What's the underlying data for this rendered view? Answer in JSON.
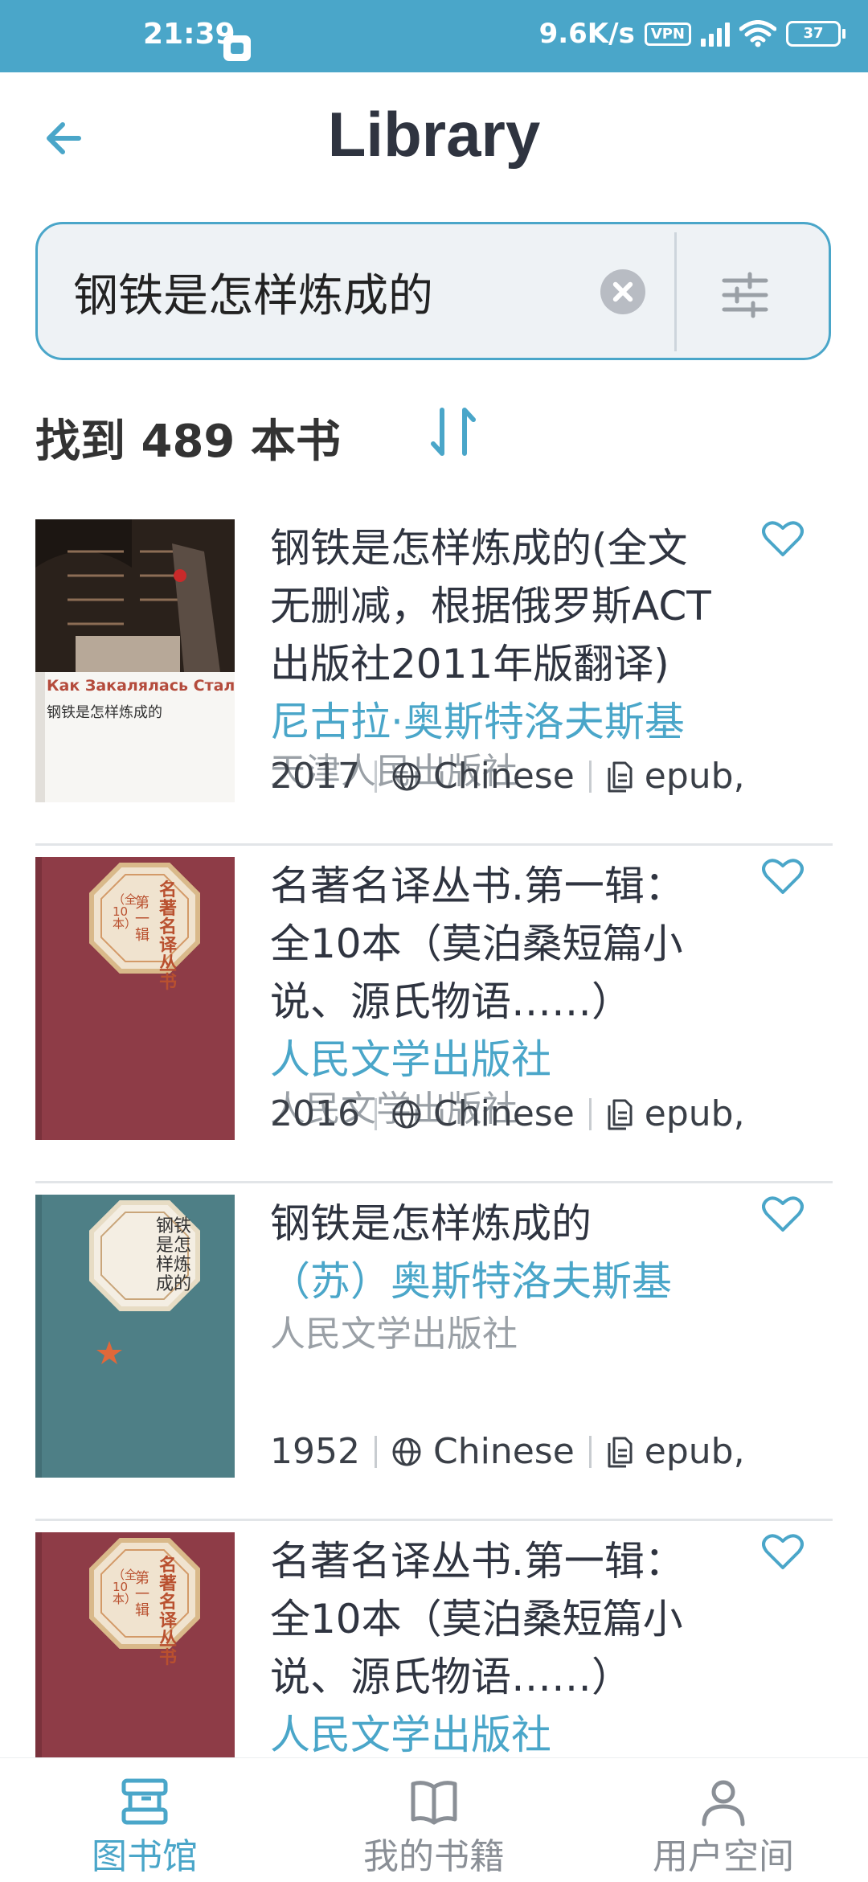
{
  "status_bar": {
    "time": "21:39",
    "speed": "9.6K/s",
    "vpn": "VPN",
    "battery": "37"
  },
  "header": {
    "title": "Library"
  },
  "search": {
    "query": "钢铁是怎样炼成的"
  },
  "results": {
    "count_text": "找到 489 本书"
  },
  "books": [
    {
      "title": "钢铁是怎样炼成的(全文无删减，根据俄罗斯ACT出版社2011年版翻译)",
      "author": "尼古拉·奥斯特洛夫斯基",
      "publisher": "天津人民出版社",
      "year": "2017",
      "language": "Chinese",
      "format": "epub,"
    },
    {
      "title": "名著名译丛书.第一辑：全10本（莫泊桑短篇小说、源氏物语……）",
      "author": "人民文学出版社",
      "publisher": "人民文学出版社",
      "year": "2016",
      "language": "Chinese",
      "format": "epub,"
    },
    {
      "title": "钢铁是怎样炼成的",
      "author": "（苏）奥斯特洛夫斯基",
      "publisher": "人民文学出版社",
      "year": "1952",
      "language": "Chinese",
      "format": "epub,"
    },
    {
      "title": "名著名译丛书.第一辑：全10本（莫泊桑短篇小说、源氏物语……）",
      "author": "人民文学出版社",
      "publisher": "",
      "year": "",
      "language": "",
      "format": ""
    }
  ],
  "covers": {
    "cover1_ru": "Как Закалялась Сталь",
    "cover1_cn": "钢铁是怎样炼成的",
    "cover2_badge": "名著名译丛书",
    "cover2_sub": "第一辑",
    "cover2_note": "（全10本）",
    "cover3_title": "钢铁是怎样炼成的"
  },
  "nav": {
    "library": "图书馆",
    "my_books": "我的书籍",
    "user_space": "用户空间"
  },
  "colors": {
    "accent": "#4aa6c9",
    "status_bar": "#4aa6c9",
    "cover_red": "#8e3c47",
    "cover_teal": "#4e7f86"
  }
}
